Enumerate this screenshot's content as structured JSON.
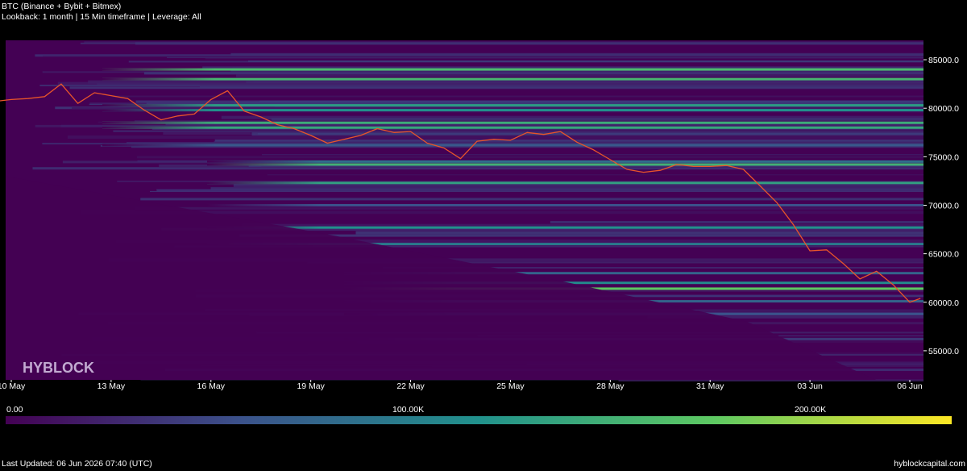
{
  "header": {
    "title": "BTC (Binance + Bybit + Bitmex)",
    "subtitle": "Lookback: 1 month | 15 Min timeframe | Leverage: All"
  },
  "watermark": "HYBLOCK",
  "colorbar": {
    "labels": [
      "0.00",
      "100.00K",
      "200.00K"
    ],
    "colors": [
      "#440154",
      "#3b528b",
      "#21918c",
      "#5ec962",
      "#fde725"
    ]
  },
  "footer": {
    "last_updated": "Last Updated: 06 Jun 2026 07:40 (UTC)",
    "site": "hyblockcapital.com"
  },
  "chart_data": {
    "type": "heatmap",
    "colormap": "viridis",
    "grid": false,
    "x_ticks": [
      "10 May",
      "13 May",
      "16 May",
      "19 May",
      "22 May",
      "25 May",
      "28 May",
      "31 May",
      "03 Jun",
      "06 Jun"
    ],
    "y_ticks": [
      "55000.0",
      "60000.0",
      "65000.0",
      "70000.0",
      "75000.0",
      "80000.0",
      "85000.0"
    ],
    "ylim": [
      52000,
      87000
    ],
    "xlim": [
      "2026-05-10",
      "2026-06-06"
    ],
    "price_line": {
      "color": "#e8542a",
      "x": [
        "2026-05-09 00:00",
        "2026-05-10 00:00",
        "2026-05-10 12:00",
        "2026-05-11 00:00",
        "2026-05-11 12:00",
        "2026-05-12 00:00",
        "2026-05-12 12:00",
        "2026-05-13 00:00",
        "2026-05-13 12:00",
        "2026-05-14 00:00",
        "2026-05-14 12:00",
        "2026-05-15 00:00",
        "2026-05-15 12:00",
        "2026-05-16 00:00",
        "2026-05-16 12:00",
        "2026-05-17 00:00",
        "2026-05-17 12:00",
        "2026-05-18 00:00",
        "2026-05-18 12:00",
        "2026-05-19 00:00",
        "2026-05-19 12:00",
        "2026-05-20 00:00",
        "2026-05-20 12:00",
        "2026-05-21 00:00",
        "2026-05-21 12:00",
        "2026-05-22 00:00",
        "2026-05-22 12:00",
        "2026-05-23 00:00",
        "2026-05-23 12:00",
        "2026-05-24 00:00",
        "2026-05-24 12:00",
        "2026-05-25 00:00",
        "2026-05-25 12:00",
        "2026-05-26 00:00",
        "2026-05-26 12:00",
        "2026-05-27 00:00",
        "2026-05-27 12:00",
        "2026-05-28 00:00",
        "2026-05-28 12:00",
        "2026-05-29 00:00",
        "2026-05-29 12:00",
        "2026-05-30 00:00",
        "2026-05-30 12:00",
        "2026-05-31 00:00",
        "2026-05-31 12:00",
        "2026-06-01 00:00",
        "2026-06-01 12:00",
        "2026-06-02 00:00",
        "2026-06-02 12:00",
        "2026-06-03 00:00",
        "2026-06-03 12:00",
        "2026-06-04 00:00",
        "2026-06-04 12:00",
        "2026-06-05 00:00",
        "2026-06-05 12:00",
        "2026-06-06 00:00",
        "2026-06-06 07:40"
      ],
      "y": [
        80500,
        80900,
        81000,
        81200,
        82500,
        80500,
        81600,
        81300,
        81000,
        79800,
        78800,
        79200,
        79400,
        80900,
        81800,
        79700,
        79100,
        78300,
        77900,
        77200,
        76400,
        76800,
        77200,
        77900,
        77500,
        77600,
        76400,
        75900,
        74800,
        76600,
        76800,
        76700,
        77500,
        77300,
        77600,
        76500,
        75700,
        74700,
        73700,
        73400,
        73600,
        74200,
        74000,
        74000,
        74100,
        73700,
        72000,
        70300,
        68000,
        65300,
        65400,
        64000,
        62400,
        63200,
        61800,
        60000,
        60400
      ]
    },
    "liquidation_bands": [
      {
        "price": 84000,
        "value": 150000
      },
      {
        "price": 83000,
        "value": 145000
      },
      {
        "price": 80300,
        "value": 120000
      },
      {
        "price": 79800,
        "value": 110000
      },
      {
        "price": 78500,
        "value": 135000
      },
      {
        "price": 78000,
        "value": 130000
      },
      {
        "price": 76200,
        "value": 60000
      },
      {
        "price": 74500,
        "value": 80000
      },
      {
        "price": 74200,
        "value": 140000
      },
      {
        "price": 72300,
        "value": 125000
      },
      {
        "price": 70000,
        "value": 55000
      },
      {
        "price": 67700,
        "value": 110000
      },
      {
        "price": 66000,
        "value": 90000
      },
      {
        "price": 63000,
        "value": 70000
      },
      {
        "price": 62000,
        "value": 105000
      },
      {
        "price": 61400,
        "value": 165000
      },
      {
        "price": 60100,
        "value": 70000
      },
      {
        "price": 58800,
        "value": 55000
      },
      {
        "price": 56200,
        "value": 35000
      }
    ]
  }
}
